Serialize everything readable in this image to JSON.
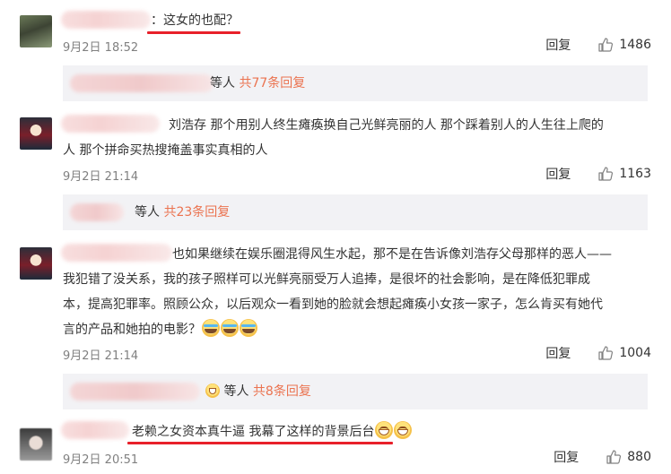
{
  "comments": [
    {
      "text": "：这女的也配？",
      "date": "9月2日 18:52",
      "reply_label": "回复",
      "likes": "1486",
      "replies": {
        "prefix": "等人",
        "count": "共77条回复"
      }
    },
    {
      "line1": "刘浩存  那个用别人终生瘫痪换自己光鲜亮丽的人  那个踩着别人的人生往上爬的",
      "line2": "人  那个拼命买热搜掩盖事实真相的人",
      "date": "9月2日 21:14",
      "reply_label": "回复",
      "likes": "1163",
      "replies": {
        "prefix": "等人",
        "count": "共23条回复"
      }
    },
    {
      "line1": "也如果继续在娱乐圈混得风生水起，那不是在告诉像刘浩存父母那样的恶人——",
      "line2": "我犯错了没关系，我的孩子照样可以光鲜亮丽受万人追捧，是很坏的社会影响，是在降低犯罪成",
      "line3": "本，提高犯罪率。照顾公众，以后观众一看到她的脸就会想起瘫痪小女孩一家子，怎么肯买有她代",
      "line4": "言的产品和她拍的电影？",
      "date": "9月2日 21:14",
      "reply_label": "回复",
      "likes": "1004",
      "replies": {
        "prefix": "等人",
        "count": "共8条回复"
      }
    },
    {
      "text": "老赖之女资本真牛逼 我幕了这样的背景后台",
      "date": "9月2日 20:51",
      "reply_label": "回复",
      "likes": "880"
    }
  ],
  "icons": {
    "like": "thumbs-up-icon",
    "cry_emoji": "crying-laughing-emoji",
    "grin_emoji": "grinning-emoji"
  },
  "colors": {
    "reply_count": "#eb7350",
    "underline": "#e8202a",
    "meta": "#808080",
    "reply_bg": "#f2f2f5"
  }
}
